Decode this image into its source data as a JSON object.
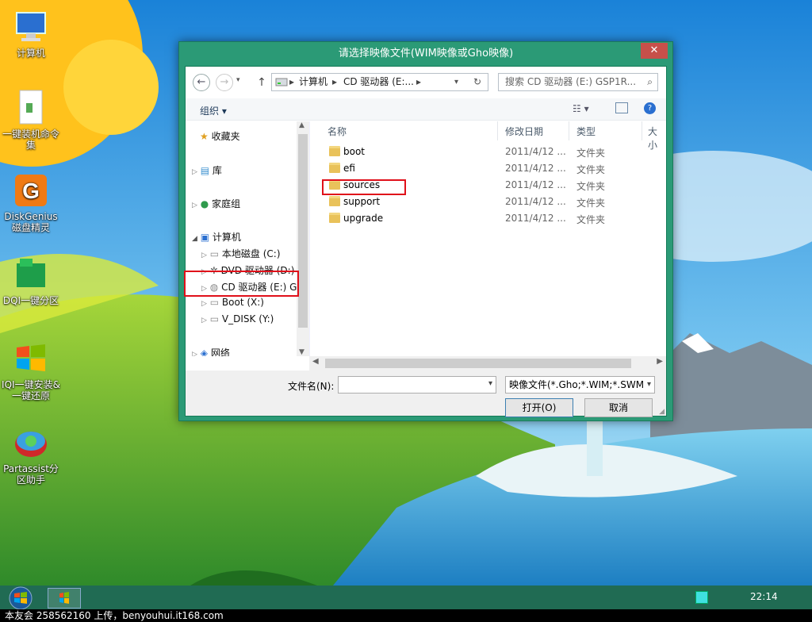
{
  "desktop": {
    "icons": [
      {
        "label": "计算机"
      },
      {
        "label": "一键装机命令集"
      },
      {
        "label": "DiskGenius磁盘精灵"
      },
      {
        "label": "DQI一键分区"
      },
      {
        "label": "IQI一键安装&一键还原"
      },
      {
        "label": "Partassist分区助手"
      }
    ]
  },
  "dialog": {
    "title": "请选择映像文件(WIM映像或Gho映像)",
    "close_label": "✕",
    "address": {
      "segments": [
        "计算机",
        "CD 驱动器 (E:..."
      ],
      "separator": "▸"
    },
    "search_placeholder": "搜索 CD 驱动器 (E:) GSP1R...",
    "toolbar": {
      "organize": "组织 ▾"
    },
    "nav": {
      "favorites": "收藏夹",
      "libraries": "库",
      "homegroup": "家庭组",
      "computer": "计算机",
      "drives": [
        "本地磁盘 (C:)",
        "DVD 驱动器 (D:)",
        "CD 驱动器 (E:) G",
        "Boot (X:)",
        "V_DISK (Y:)"
      ],
      "network": "网络"
    },
    "columns": {
      "name": "名称",
      "modified": "修改日期",
      "type": "类型",
      "size": "大小"
    },
    "files": [
      {
        "name": "boot",
        "modified": "2011/4/12 ...",
        "type": "文件夹"
      },
      {
        "name": "efi",
        "modified": "2011/4/12 ...",
        "type": "文件夹"
      },
      {
        "name": "sources",
        "modified": "2011/4/12 ...",
        "type": "文件夹"
      },
      {
        "name": "support",
        "modified": "2011/4/12 ...",
        "type": "文件夹"
      },
      {
        "name": "upgrade",
        "modified": "2011/4/12 ...",
        "type": "文件夹"
      }
    ],
    "filename_label": "文件名(N):",
    "filename_value": "",
    "filter_value": "映像文件(*.Gho;*.WIM;*.SWM",
    "open_button": "打开(O)",
    "cancel_button": "取消"
  },
  "taskbar": {
    "clock": "22:14"
  },
  "footer": "本友会 258562160 上传，benyouhui.it168.com",
  "colors": {
    "dialog_frame": "#2b9a76",
    "taskbar": "#206b53",
    "highlight_box": "#e0101a"
  }
}
